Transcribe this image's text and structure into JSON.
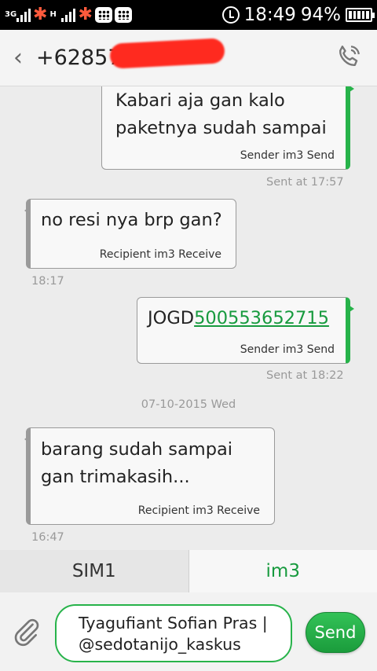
{
  "status_bar": {
    "network_1": "3G",
    "network_2": "H",
    "time": "18:49",
    "battery_percent": "94%",
    "battery_level": 0.94
  },
  "header": {
    "contact_number": "+628577",
    "back_icon": "back-chevron-icon",
    "call_icon": "phone-icon"
  },
  "messages": [
    {
      "direction": "outgoing",
      "text": "Kabari aja gan kalo\npaketnya sudah sampai",
      "meta": "Sender im3 Send",
      "time": "Sent at 17:57"
    },
    {
      "direction": "incoming",
      "text": "no resi nya brp gan?",
      "meta": "Recipient im3 Receive",
      "time": "18:17"
    },
    {
      "direction": "outgoing",
      "text_prefix": "JOGD",
      "text_link": "500553652715",
      "meta": "Sender im3 Send",
      "time": "Sent at 18:22"
    },
    {
      "direction": "incoming",
      "text": "barang sudah sampai\ngan trimakasih...",
      "meta": "Recipient im3 Receive",
      "time": "16:47"
    }
  ],
  "date_separator": "07-10-2015 Wed",
  "sim_tabs": [
    {
      "label": "SIM1",
      "selected": false
    },
    {
      "label": "im3",
      "selected": true
    }
  ],
  "compose": {
    "text": "Tyagufiant Sofian Pras |\n@sedotanijo_kaskus",
    "send_label": "Send",
    "attach_icon": "paperclip-icon"
  },
  "colors": {
    "accent_green": "#27b34a",
    "redaction": "#ff2a1f"
  }
}
